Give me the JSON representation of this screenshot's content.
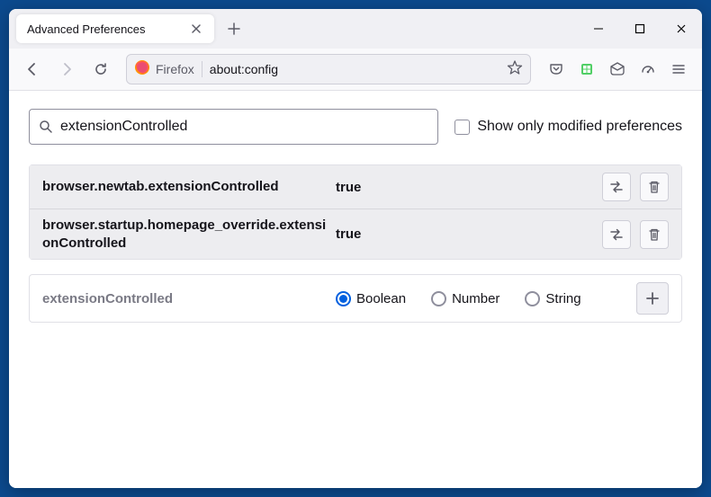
{
  "titlebar": {
    "tab_title": "Advanced Preferences"
  },
  "toolbar": {
    "identity_label": "Firefox",
    "url": "about:config"
  },
  "search": {
    "value": "extensionControlled",
    "checkbox_label": "Show only modified preferences"
  },
  "prefs": [
    {
      "name": "browser.newtab.extensionControlled",
      "value": "true"
    },
    {
      "name": "browser.startup.homepage_override.extensionControlled",
      "value": "true"
    }
  ],
  "add": {
    "name": "extensionControlled",
    "types": [
      "Boolean",
      "Number",
      "String"
    ],
    "selected": 0
  }
}
